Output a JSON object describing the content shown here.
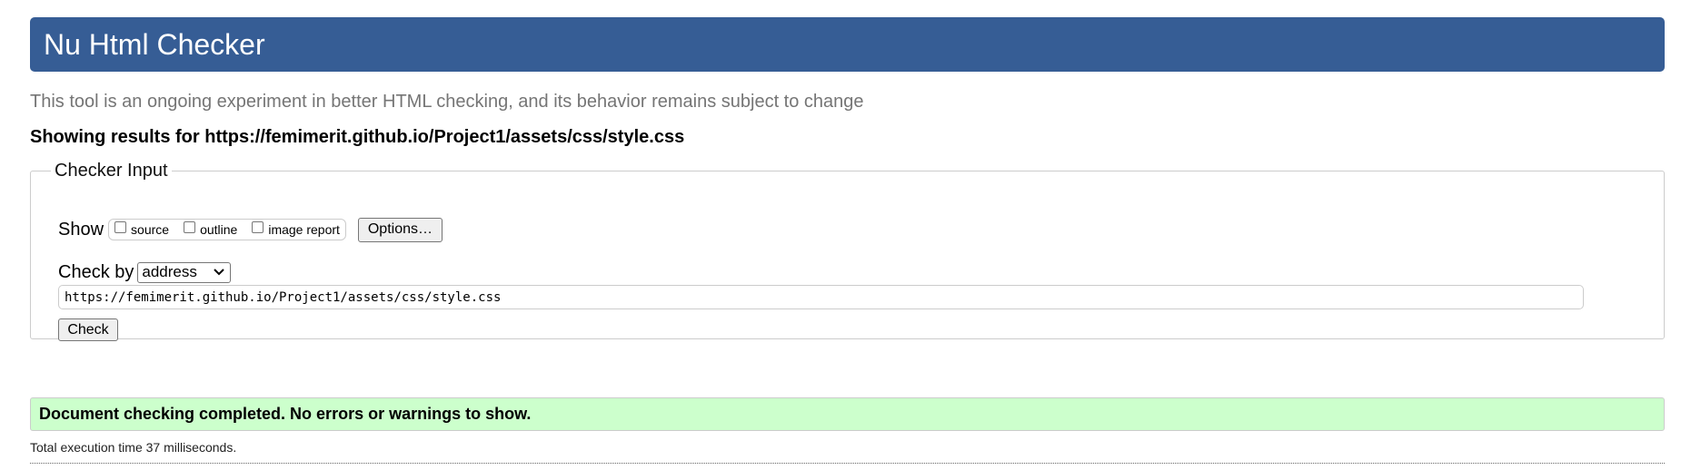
{
  "header": {
    "title": "Nu Html Checker",
    "background_color": "#365d95"
  },
  "subtitle": "This tool is an ongoing experiment in better HTML checking, and its behavior remains subject to change",
  "results_for": "Showing results for https://femimerit.github.io/Project1/assets/css/style.css",
  "checker_input": {
    "legend": "Checker Input",
    "show_label": "Show",
    "show_options": [
      {
        "label": "source",
        "checked": false
      },
      {
        "label": "outline",
        "checked": false
      },
      {
        "label": "image report",
        "checked": false
      }
    ],
    "options_button_label": "Options…",
    "check_by_label": "Check by",
    "check_by_selected": "address",
    "url_value": "https://femimerit.github.io/Project1/assets/css/style.css",
    "check_button_label": "Check"
  },
  "result": {
    "message": "Document checking completed. No errors or warnings to show.",
    "background_color": "#ccffcc"
  },
  "execution_time": "Total execution time 37 milliseconds."
}
